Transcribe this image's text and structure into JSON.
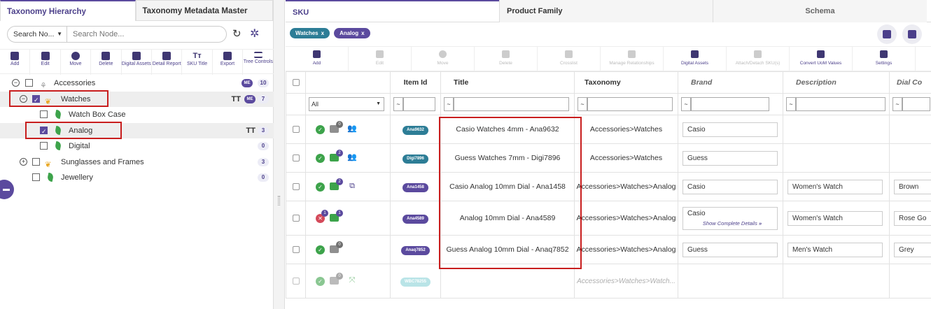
{
  "left": {
    "tabs": [
      "Taxonomy Hierarchy",
      "Taxonomy Metadata Master"
    ],
    "search": {
      "select_label": "Search No...",
      "placeholder": "Search Node..."
    },
    "toolbar": [
      "Add",
      "Edit",
      "Move",
      "Delete",
      "Digital Assets",
      "Detail Report",
      "SKU Title",
      "Export",
      "Tree Controls"
    ],
    "tree": [
      {
        "label": "Accessories",
        "badge": "ME",
        "count": "10"
      },
      {
        "label": "Watches",
        "tt": "TT",
        "badge": "ME",
        "count": "7"
      },
      {
        "label": "Watch Box Case"
      },
      {
        "label": "Analog",
        "tt": "TT",
        "count": "3"
      },
      {
        "label": "Digital",
        "count": "0"
      },
      {
        "label": "Sunglasses and Frames",
        "count": "3"
      },
      {
        "label": "Jewellery",
        "count": "0"
      }
    ]
  },
  "right": {
    "tabs": [
      "SKU",
      "Product Family",
      "Schema"
    ],
    "chips": [
      {
        "label": "Watches",
        "x": "x"
      },
      {
        "label": "Analog",
        "x": "x"
      }
    ],
    "toolbar": [
      "Add",
      "Edit",
      "Move",
      "Delete",
      "Crosslist",
      "Manage Relationships",
      "Digital Assets",
      "Attach/Detach SKU(s)",
      "Convert UoM Values",
      "Settings"
    ],
    "columns": [
      "Item Id",
      "Title",
      "Taxonomy",
      "Brand",
      "Description",
      "Dial Co"
    ],
    "filter": {
      "select": "All",
      "op": "~"
    },
    "rows": [
      {
        "id": "Ana9632",
        "img_count": "0",
        "title": "Casio  Watches 4mm  - Ana9632",
        "taxonomy": "Accessories>Watches",
        "brand": "Casio",
        "description": "",
        "dial": ""
      },
      {
        "id": "Digi7896",
        "img_count": "2",
        "title": "Guess  Watches 7mm  - Digi7896",
        "taxonomy": "Accessories>Watches",
        "brand": "Guess",
        "description": "",
        "dial": ""
      },
      {
        "id": "Ana1458",
        "img_count": "2",
        "title": "Casio  Analog 10mm Dial - Ana1458",
        "taxonomy": "Accessories>Watches>Analog",
        "brand": "Casio",
        "description": "Women's Watch",
        "dial": "Brown"
      },
      {
        "id": "Ana4589",
        "err_count": "1",
        "img_count": "1",
        "title": "Analog 10mm Dial - Ana4589",
        "taxonomy": "Accessories>Watches>Analog",
        "brand": "Casio",
        "brand_link": "Show Complete Details",
        "description": "Women's Watch",
        "dial": "Rose Go"
      },
      {
        "id": "Anaq7852",
        "img_count": "0",
        "title": "Guess  Analog 10mm Dial - Anaq7852",
        "taxonomy": "Accessories>Watches>Analog",
        "brand": "Guess",
        "description": "Men's Watch",
        "dial": "Grey"
      },
      {
        "id": "WBC78255",
        "img_count": "0",
        "title": "",
        "taxonomy": "Accessories>Watches>Watch...",
        "brand": "",
        "description": "",
        "dial": ""
      }
    ]
  }
}
